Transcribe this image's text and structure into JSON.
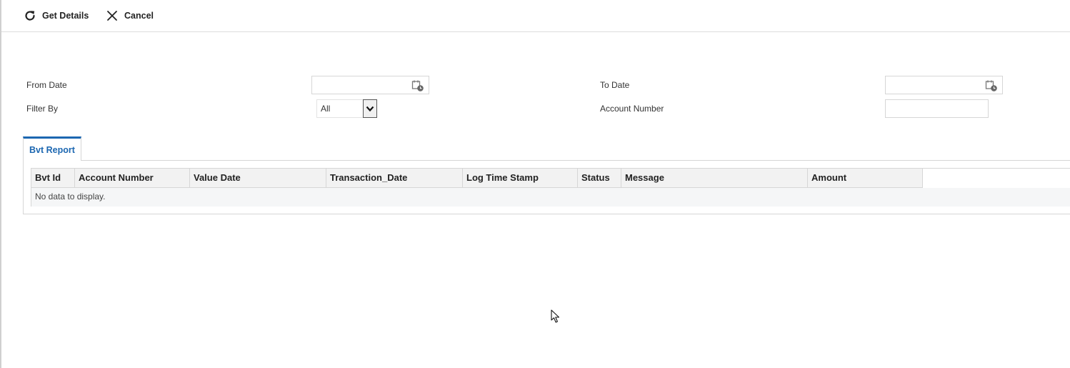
{
  "toolbar": {
    "get_details": {
      "label": "Get Details",
      "icon": "refresh-icon"
    },
    "cancel": {
      "label": "Cancel",
      "icon": "close-icon"
    }
  },
  "form": {
    "from_date": {
      "label": "From Date",
      "value": "",
      "icon": "calendar-icon"
    },
    "to_date": {
      "label": "To Date",
      "value": "",
      "icon": "calendar-icon"
    },
    "filter_by": {
      "label": "Filter By",
      "selected": "All"
    },
    "account_number": {
      "label": "Account Number",
      "value": ""
    }
  },
  "tabs": [
    {
      "label": "Bvt Report",
      "active": true
    }
  ],
  "table": {
    "columns": [
      "Bvt Id",
      "Account Number",
      "Value Date",
      "Transaction_Date",
      "Log Time Stamp",
      "Status",
      "Message",
      "Amount"
    ],
    "empty_message": "No data to display."
  },
  "colors": {
    "accent": "#1c67b1",
    "border": "#d6d6d6",
    "header_bg": "#f2f2f2"
  }
}
